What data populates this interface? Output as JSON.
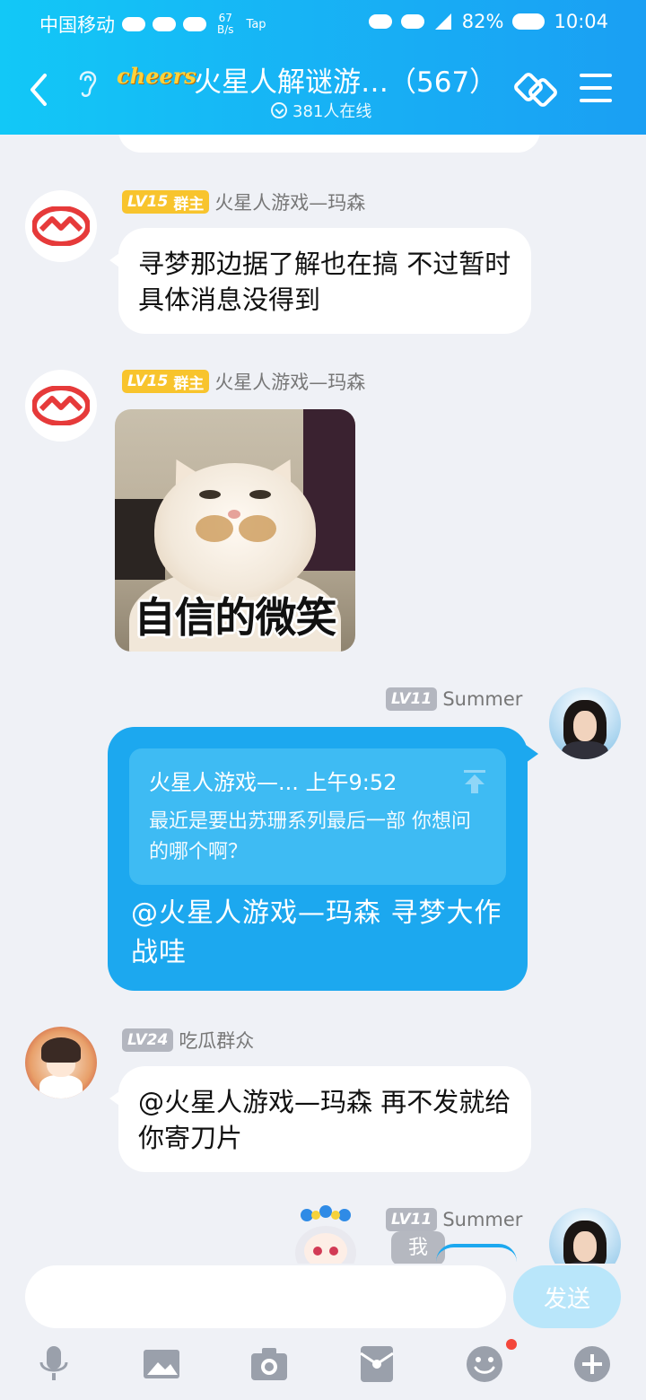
{
  "status_bar": {
    "carrier": "中国移动",
    "net_speed_value": "67",
    "net_speed_unit": "B/s",
    "tap": "Tap",
    "battery": "82%",
    "time": "10:04"
  },
  "header": {
    "badge": "cheers",
    "title": "火星人解谜游…（567）",
    "online": "381人在线"
  },
  "messages": [
    {
      "level": "LV15",
      "role": "群主",
      "sender": "火星人游戏—玛森",
      "text": "寻梦那边据了解也在搞 不过暂时具体消息没得到"
    },
    {
      "level": "LV15",
      "role": "群主",
      "sender": "火星人游戏—玛森",
      "image_caption": "自信的微笑"
    },
    {
      "level": "LV11",
      "sender": "Summer",
      "quote_header": "火星人游戏—... 上午9:52",
      "quote_text": "最近是要出苏珊系列最后一部 你想问的哪个啊？",
      "text": "@火星人游戏—玛森 寻梦大作战哇"
    },
    {
      "level": "LV24",
      "sender": "吃瓜群众",
      "text": "@火星人游戏—玛森 再不发就给你寄刀片"
    },
    {
      "level": "LV11",
      "sender": "Summer",
      "tag": "我"
    }
  ],
  "input": {
    "placeholder": "",
    "send_label": "发送"
  },
  "toolbar": {
    "icons": [
      "microphone-icon",
      "picture-icon",
      "camera-icon",
      "red-packet-icon",
      "emoji-icon",
      "plus-icon"
    ]
  },
  "colors": {
    "header_start": "#12c8f7",
    "header_end": "#1a9ff3",
    "bubble_blue": "#1ca8ef",
    "level_gold": "#f8c42d",
    "send_disabled": "#b9e6fa"
  }
}
